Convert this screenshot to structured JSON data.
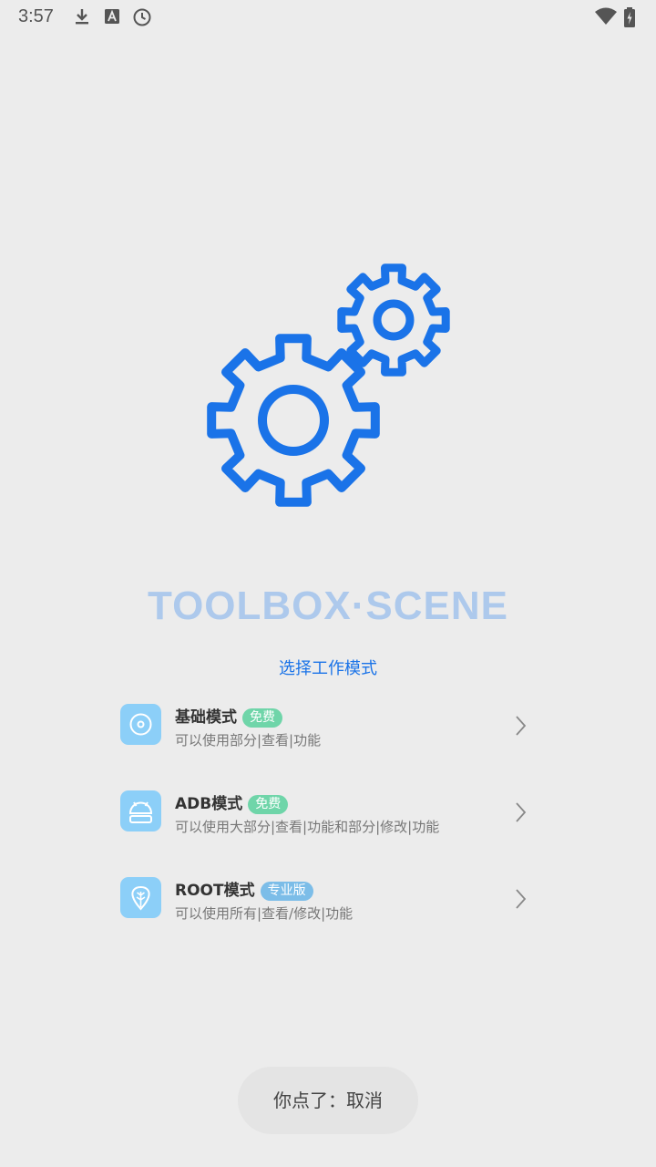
{
  "status_bar": {
    "time": "3:57",
    "icons": [
      "download-icon",
      "text-a-icon",
      "clock-icon",
      "wifi-icon",
      "battery-charging-icon"
    ]
  },
  "hero": {
    "icon": "gears-icon",
    "color": "#1a73e8"
  },
  "app_title": "TOOLBOX·SCENE",
  "mode_prompt": "选择工作模式",
  "modes": [
    {
      "name": "基础模式",
      "badge": "免费",
      "description": "可以使用部分|查看|功能",
      "icon": "disc-icon"
    },
    {
      "name": "ADB模式",
      "badge": "免费",
      "description": "可以使用大部分|查看|功能和部分|修改|功能",
      "icon": "android-icon"
    },
    {
      "name": "ROOT模式",
      "badge": "专业版",
      "description": "可以使用所有|查看/修改|功能",
      "icon": "shield-leaf-icon"
    }
  ],
  "toast": "你点了：取消",
  "colors": {
    "accent": "#1a73e8",
    "title": "#adc9ec",
    "free_badge": "#6fd5a9",
    "pro_badge": "#7cbde8",
    "mode_icon_bg": "#8ccff8"
  }
}
